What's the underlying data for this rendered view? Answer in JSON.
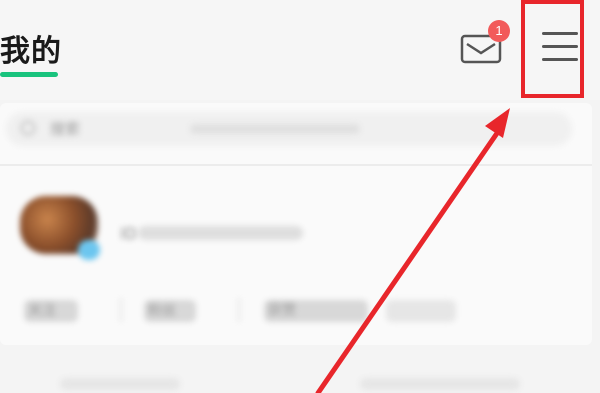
{
  "header": {
    "title": "我的",
    "mail_badge": "1"
  },
  "search": {
    "placeholder": "搜索"
  },
  "profile": {
    "id_prefix": "ID"
  },
  "stats": [
    {
      "label": "关注"
    },
    {
      "label": "粉丝"
    },
    {
      "label": "获赞"
    }
  ],
  "icons": {
    "mail": "mail-icon",
    "menu": "menu-icon",
    "search": "search-icon"
  },
  "colors": {
    "accent": "#19c37d",
    "badge": "#f25a5a",
    "annotation": "#e8262b"
  }
}
